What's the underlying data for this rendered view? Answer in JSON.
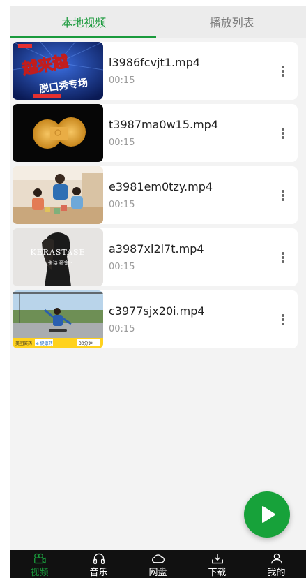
{
  "tabs": [
    {
      "label": "本地视频",
      "active": true
    },
    {
      "label": "播放列表",
      "active": false
    }
  ],
  "videos": [
    {
      "filename": "l3986fcvjt1.mp4",
      "duration": "00:15",
      "thumb": "show-promo"
    },
    {
      "filename": "t3987ma0w15.mp4",
      "duration": "00:15",
      "thumb": "golden-object"
    },
    {
      "filename": "e3981em0tzy.mp4",
      "duration": "00:15",
      "thumb": "family-room"
    },
    {
      "filename": "a3987xl2l7t.mp4",
      "duration": "00:15",
      "thumb": "kerastase-ad"
    },
    {
      "filename": "c3977sjx20i.mp4",
      "duration": "00:15",
      "thumb": "skateboard-kid"
    }
  ],
  "thumb_texts": {
    "show_title": "越来越",
    "show_subtitle": "脱口秀专场",
    "brand": "KERASTASE",
    "brand_sub": "卡诗 奢宠 ·",
    "ad_left": "美团买药",
    "ad_mid": "e 健康药",
    "ad_right": "30分钟"
  },
  "fab": {
    "icon": "play-icon"
  },
  "bottom_nav": [
    {
      "label": "视频",
      "icon": "video-camera-icon",
      "active": true
    },
    {
      "label": "音乐",
      "icon": "headphones-icon",
      "active": false
    },
    {
      "label": "网盘",
      "icon": "cloud-icon",
      "active": false
    },
    {
      "label": "下载",
      "icon": "download-icon",
      "active": false
    },
    {
      "label": "我的",
      "icon": "user-icon",
      "active": false
    }
  ],
  "colors": {
    "accent": "#1a9a3c",
    "nav_bg": "#111111"
  }
}
